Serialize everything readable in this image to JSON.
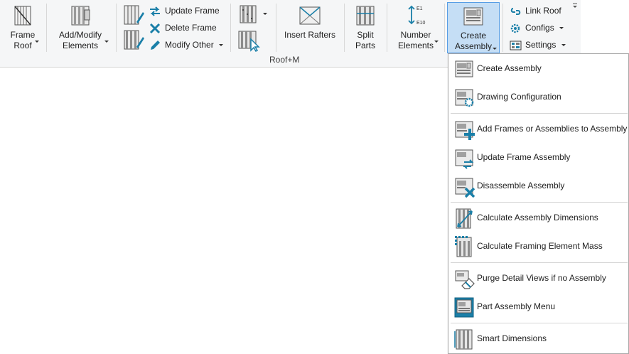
{
  "ribbon": {
    "panel_title": "Roof+M",
    "frame_roof": {
      "line1": "Frame",
      "line2": "Roof"
    },
    "add_modify": {
      "line1": "Add/Modify",
      "line2": "Elements"
    },
    "update_frame": "Update Frame",
    "delete_frame": "Delete Frame",
    "modify_other": "Modify Other",
    "insert_rafters": "Insert Rafters",
    "split_parts": {
      "line1": "Split",
      "line2": "Parts"
    },
    "number_elements": {
      "line1": "Number",
      "line2": "Elements",
      "top_tag": "E1",
      "bottom_tag": "E10"
    },
    "create_assembly": {
      "line1": "Create",
      "line2": "Assembly"
    },
    "link_roof": "Link Roof",
    "configs": "Configs",
    "settings": "Settings"
  },
  "menu": {
    "items": [
      {
        "label": "Create Assembly",
        "icon": "create-assembly-icon"
      },
      {
        "label": "Drawing Configuration",
        "icon": "drawing-configuration-icon"
      },
      {
        "label": "Add Frames or Assemblies to Assembly",
        "icon": "add-to-assembly-icon"
      },
      {
        "label": "Update Frame Assembly",
        "icon": "update-assembly-icon"
      },
      {
        "label": "Disassemble Assembly",
        "icon": "disassemble-icon"
      },
      {
        "label": "Calculate Assembly Dimensions",
        "icon": "dimensions-icon"
      },
      {
        "label": "Calculate Framing Element Mass",
        "icon": "mass-icon"
      },
      {
        "label": "Purge Detail Views if no Assembly",
        "icon": "purge-icon"
      },
      {
        "label": "Part Assembly Menu",
        "icon": "part-assembly-icon"
      },
      {
        "label": "Smart Dimensions",
        "icon": "smart-dimensions-icon"
      }
    ]
  },
  "colors": {
    "accent": "#1a7fa8",
    "active_bg": "#c5def5",
    "active_border": "#569de5"
  }
}
